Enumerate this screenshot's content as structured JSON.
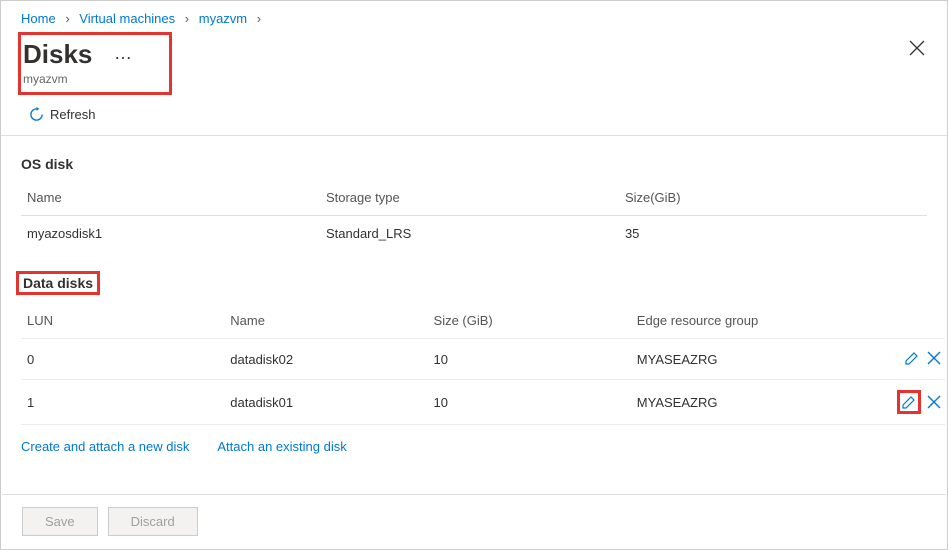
{
  "breadcrumb": {
    "home": "Home",
    "vms": "Virtual machines",
    "vm": "myazvm"
  },
  "header": {
    "title": "Disks",
    "subtitle": "myazvm",
    "ellipsis": "…"
  },
  "refresh_label": "Refresh",
  "os_section": {
    "heading": "OS disk",
    "cols": {
      "name": "Name",
      "storage": "Storage type",
      "size": "Size(GiB)"
    },
    "row": {
      "name": "myazosdisk1",
      "storage": "Standard_LRS",
      "size": "35"
    }
  },
  "data_section": {
    "heading": "Data disks",
    "cols": {
      "lun": "LUN",
      "name": "Name",
      "size": "Size (GiB)",
      "erg": "Edge resource group"
    },
    "rows": [
      {
        "lun": "0",
        "name": "datadisk02",
        "size": "10",
        "erg": "MYASEAZRG"
      },
      {
        "lun": "1",
        "name": "datadisk01",
        "size": "10",
        "erg": "MYASEAZRG"
      }
    ]
  },
  "links": {
    "create": "Create and attach a new disk",
    "attach": "Attach an existing disk"
  },
  "footer": {
    "save": "Save",
    "discard": "Discard"
  }
}
